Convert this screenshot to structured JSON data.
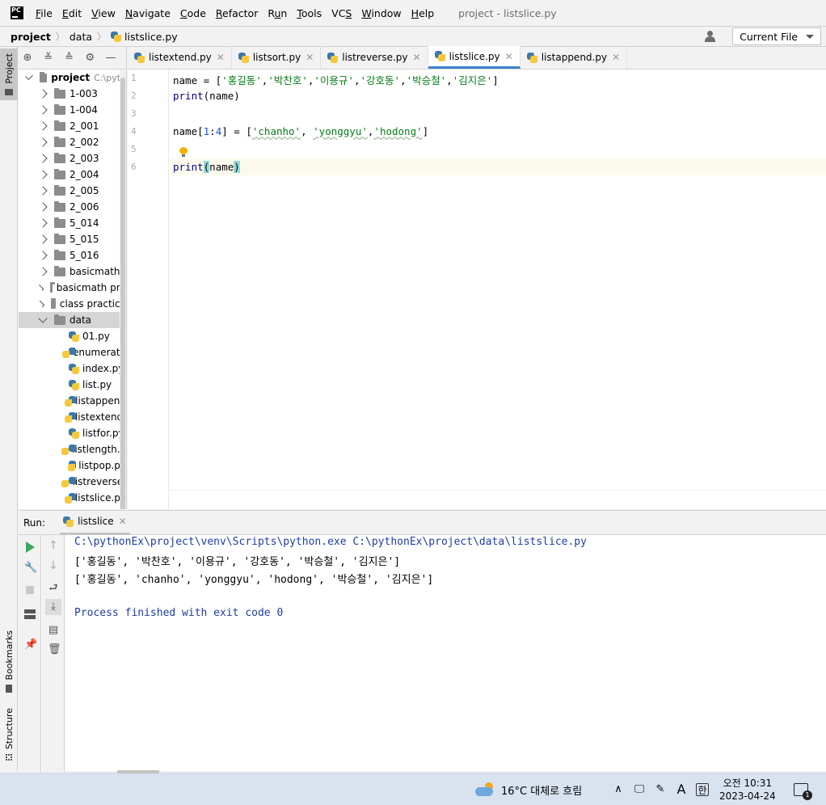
{
  "menubar": {
    "logo_text": "PC",
    "items": [
      {
        "pre": "",
        "u": "F",
        "post": "ile"
      },
      {
        "pre": "",
        "u": "E",
        "post": "dit"
      },
      {
        "pre": "",
        "u": "V",
        "post": "iew"
      },
      {
        "pre": "",
        "u": "N",
        "post": "avigate"
      },
      {
        "pre": "",
        "u": "C",
        "post": "ode"
      },
      {
        "pre": "",
        "u": "R",
        "post": "efactor"
      },
      {
        "pre": "R",
        "u": "u",
        "post": "n"
      },
      {
        "pre": "",
        "u": "T",
        "post": "ools"
      },
      {
        "pre": "VC",
        "u": "S",
        "post": ""
      },
      {
        "pre": "",
        "u": "W",
        "post": "indow"
      },
      {
        "pre": "",
        "u": "H",
        "post": "elp"
      }
    ],
    "window_title": "project - listslice.py"
  },
  "navbar": {
    "crumbs": [
      "project",
      "data",
      "listslice.py"
    ],
    "current_file_label": "Current File"
  },
  "left_strip": {
    "project_label": "Project",
    "bookmarks_label": "Bookmarks",
    "structure_label": "Structure"
  },
  "project_tree": {
    "root_name": "project",
    "root_path": "C:\\pyth",
    "folders": [
      "1-003",
      "1-004",
      "2_001",
      "2_002",
      "2_003",
      "2_004",
      "2_005",
      "2_006",
      "5_014",
      "5_015",
      "5_016",
      "basicmath",
      "basicmath pra",
      "class practice"
    ],
    "open_folder": "data",
    "files": [
      "01.py",
      "enumerate",
      "index.py",
      "list.py",
      "listappend",
      "listextend.",
      "listfor.py",
      "listlength.p",
      "listpop.py",
      "listreverse.",
      "listslice.py"
    ]
  },
  "editor": {
    "tabs": [
      "listextend.py",
      "listsort.py",
      "listreverse.py",
      "listslice.py",
      "listappend.py"
    ],
    "active_tab": "listslice.py",
    "line_numbers": [
      "1",
      "2",
      "3",
      "4",
      "5",
      "6"
    ],
    "code": {
      "l1_a": "name = [",
      "l1_s1": "'홍길동'",
      "l1_c": ",",
      "l1_s2": "'박찬호'",
      "l1_s3": "'이용규'",
      "l1_s4": "'강호동'",
      "l1_s5": "'박승철'",
      "l1_s6": "'김지은'",
      "l1_end": "]",
      "l2_kw": "print",
      "l2_rest": "(name)",
      "l4_a": "name[",
      "l4_n1": "1",
      "l4_colon": ":",
      "l4_n2": "4",
      "l4_b": "] = [",
      "l4_s1": "'chanho'",
      "l4_sep1": ", ",
      "l4_s2": "'yonggyu'",
      "l4_sep2": ",",
      "l4_s3": "'hodong'",
      "l4_end": "]",
      "l6_kw": "print",
      "l6_open": "(",
      "l6_mid": "name",
      "l6_close": ")"
    }
  },
  "run": {
    "label": "Run:",
    "tab": "listslice",
    "output": [
      "C:\\pythonEx\\project\\venv\\Scripts\\python.exe C:\\pythonEx\\project\\data\\listslice.py",
      "['홍길동', '박찬호', '이용규', '강호동', '박승철', '김지은']",
      "['홍길동', 'chanho', 'yonggyu', 'hodong', '박승철', '김지은']",
      "",
      "Process finished with exit code 0"
    ]
  },
  "taskbar": {
    "weather": "16°C 대체로 흐림",
    "ime_a": "A",
    "ime_han": "한",
    "time": "오전 10:31",
    "date": "2023-04-24",
    "notif_count": "1"
  },
  "colors": {
    "accent": "#4083c9",
    "keyword": "#000080",
    "string": "#067d17",
    "number": "#1750eb",
    "console_blue": "#1f3ca6"
  }
}
